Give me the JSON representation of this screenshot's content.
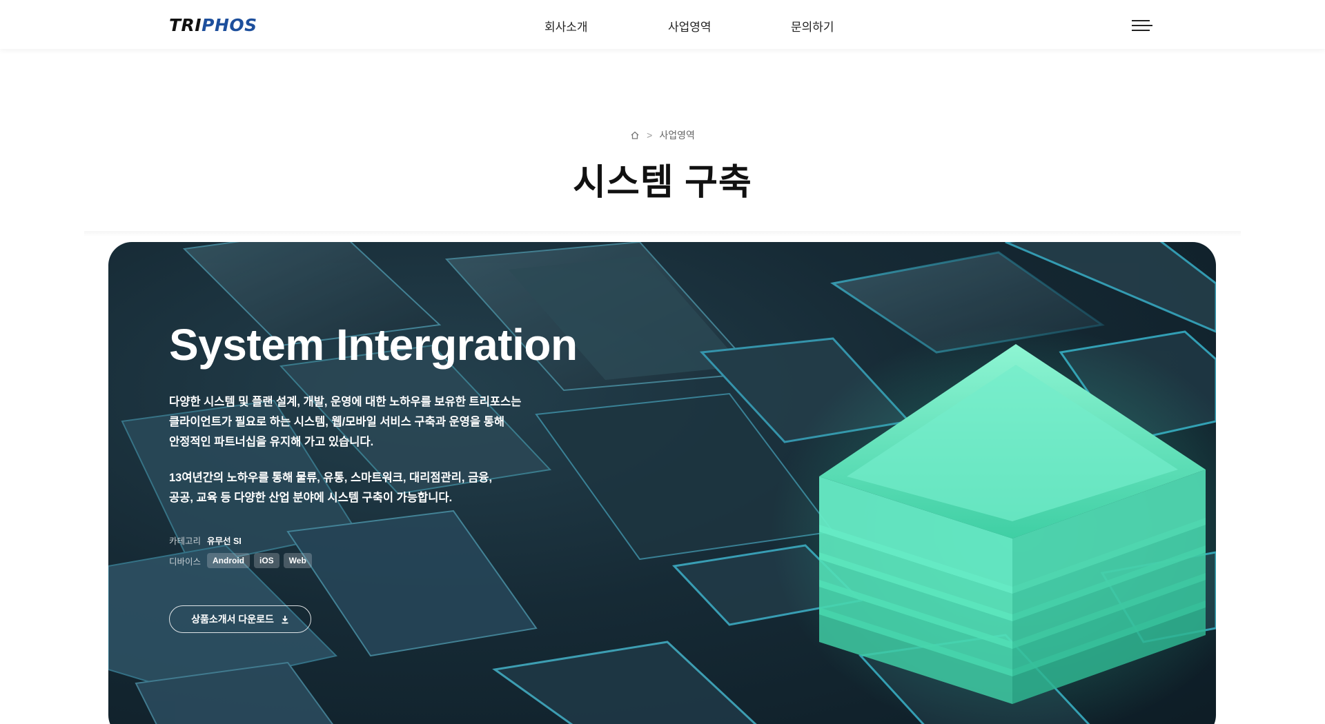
{
  "header": {
    "logo": {
      "part1": "TRI",
      "part2": "P",
      "part3": "HOS"
    },
    "nav": [
      {
        "label": "회사소개"
      },
      {
        "label": "사업영역"
      },
      {
        "label": "문의하기"
      }
    ],
    "menu_icon": "hamburger-menu-icon"
  },
  "breadcrumb": {
    "home_icon": "home-icon",
    "separator": ">",
    "current": "사업영역"
  },
  "page_title": "시스템 구축",
  "hero": {
    "heading": "System Intergration",
    "paragraph1": [
      "다양한 시스템 및 플랜 설계, 개발, 운영에 대한 노하우를 보유한 트리포스는",
      "클라이언트가 필요로 하는 시스템, 웹/모바일 서비스 구축과 운영을 통해",
      "안정적인 파트너십을 유지해 가고 있습니다."
    ],
    "paragraph2": [
      "13여년간의 노하우를 통해 물류, 유통, 스마트워크, 대리점관리, 금융,",
      "공공, 교육 등 다양한 산업 분야에 시스템 구축이 가능합니다."
    ],
    "category": {
      "label": "카테고리",
      "value": "유무선 SI"
    },
    "device": {
      "label": "디바이스",
      "tags": [
        "Android",
        "iOS",
        "Web"
      ]
    },
    "download_button": {
      "label": "상품소개서 다운로드",
      "icon": "download-icon"
    }
  },
  "colors": {
    "logo_accent": "#1d4f9c",
    "hero_bg": "#162a35",
    "glow_green": "#5fe3bd"
  }
}
